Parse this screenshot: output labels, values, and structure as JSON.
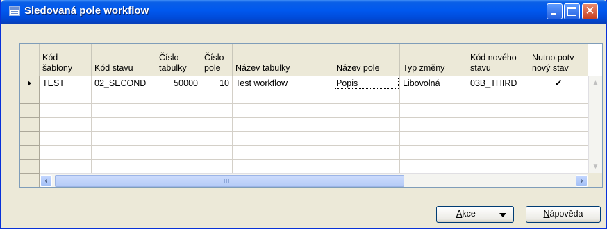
{
  "window": {
    "title": "Sledovaná pole workflow",
    "controls": {
      "minimize_icon": "minimize-icon",
      "maximize_icon": "maximize-icon",
      "close_icon": "close-icon"
    }
  },
  "grid": {
    "columns": [
      {
        "line1": "Kód",
        "line2": "šablony"
      },
      {
        "line1": "",
        "line2": "Kód stavu"
      },
      {
        "line1": "Číslo",
        "line2": "tabulky"
      },
      {
        "line1": "Číslo",
        "line2": "pole"
      },
      {
        "line1": "",
        "line2": "Název tabulky"
      },
      {
        "line1": "",
        "line2": "Název pole"
      },
      {
        "line1": "",
        "line2": "Typ změny"
      },
      {
        "line1": "Kód nového",
        "line2": "stavu"
      },
      {
        "line1": "Nutno potv",
        "line2": "nový stav"
      }
    ],
    "rows": [
      [
        "TEST",
        "02_SECOND",
        "50000",
        "10",
        "Test workflow",
        "Popis",
        "Libovolná",
        "03B_THIRD",
        "✔"
      ],
      [
        "",
        "",
        "",
        "",
        "",
        "",
        "",
        "",
        ""
      ],
      [
        "",
        "",
        "",
        "",
        "",
        "",
        "",
        "",
        ""
      ],
      [
        "",
        "",
        "",
        "",
        "",
        "",
        "",
        "",
        ""
      ],
      [
        "",
        "",
        "",
        "",
        "",
        "",
        "",
        "",
        ""
      ],
      [
        "",
        "",
        "",
        "",
        "",
        "",
        "",
        "",
        ""
      ],
      [
        "",
        "",
        "",
        "",
        "",
        "",
        "",
        "",
        ""
      ]
    ],
    "selected_row": 0,
    "focused_cell": {
      "row": 0,
      "col": 5
    }
  },
  "footer": {
    "actions_label": "Akce",
    "help_label": "Nápověda"
  },
  "colors": {
    "titlebar": "#0058ee",
    "window_bg": "#ece9d8",
    "grid_bg": "#ffffff"
  }
}
